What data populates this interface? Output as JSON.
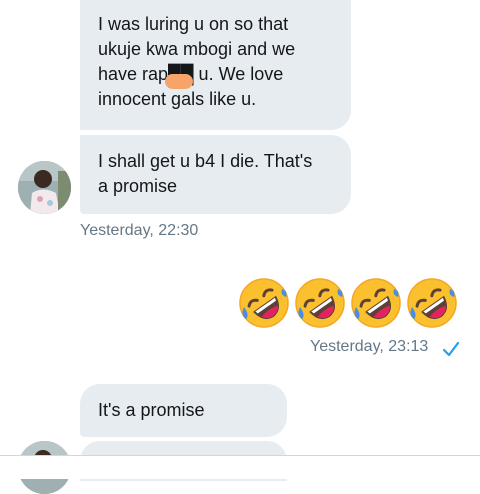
{
  "conversation": {
    "messages_in": [
      {
        "lines": [
          "I was luring u on so that",
          "ukuje kwa mbogi and we",
          "have rap██ u. We love",
          "innocent gals like u."
        ]
      },
      {
        "lines": [
          "I shall get u b4 I die. That's",
          "a promise"
        ]
      }
    ],
    "timestamp_in": "Yesterday, 22:30",
    "outgoing": {
      "emoji_name": "rolling-on-the-floor-laughing-icon",
      "emoji_count": 4,
      "timestamp": "Yesterday, 23:13",
      "status_icon": "check-icon",
      "status_color": "#1da1f2"
    },
    "messages_in_2": [
      {
        "text": "It's a promise"
      }
    ]
  },
  "colors": {
    "bubble_bg": "#e6ecf0",
    "timestamp": "#657786",
    "redaction": "#f6a46a",
    "emoji_face": "#fbc02d"
  }
}
